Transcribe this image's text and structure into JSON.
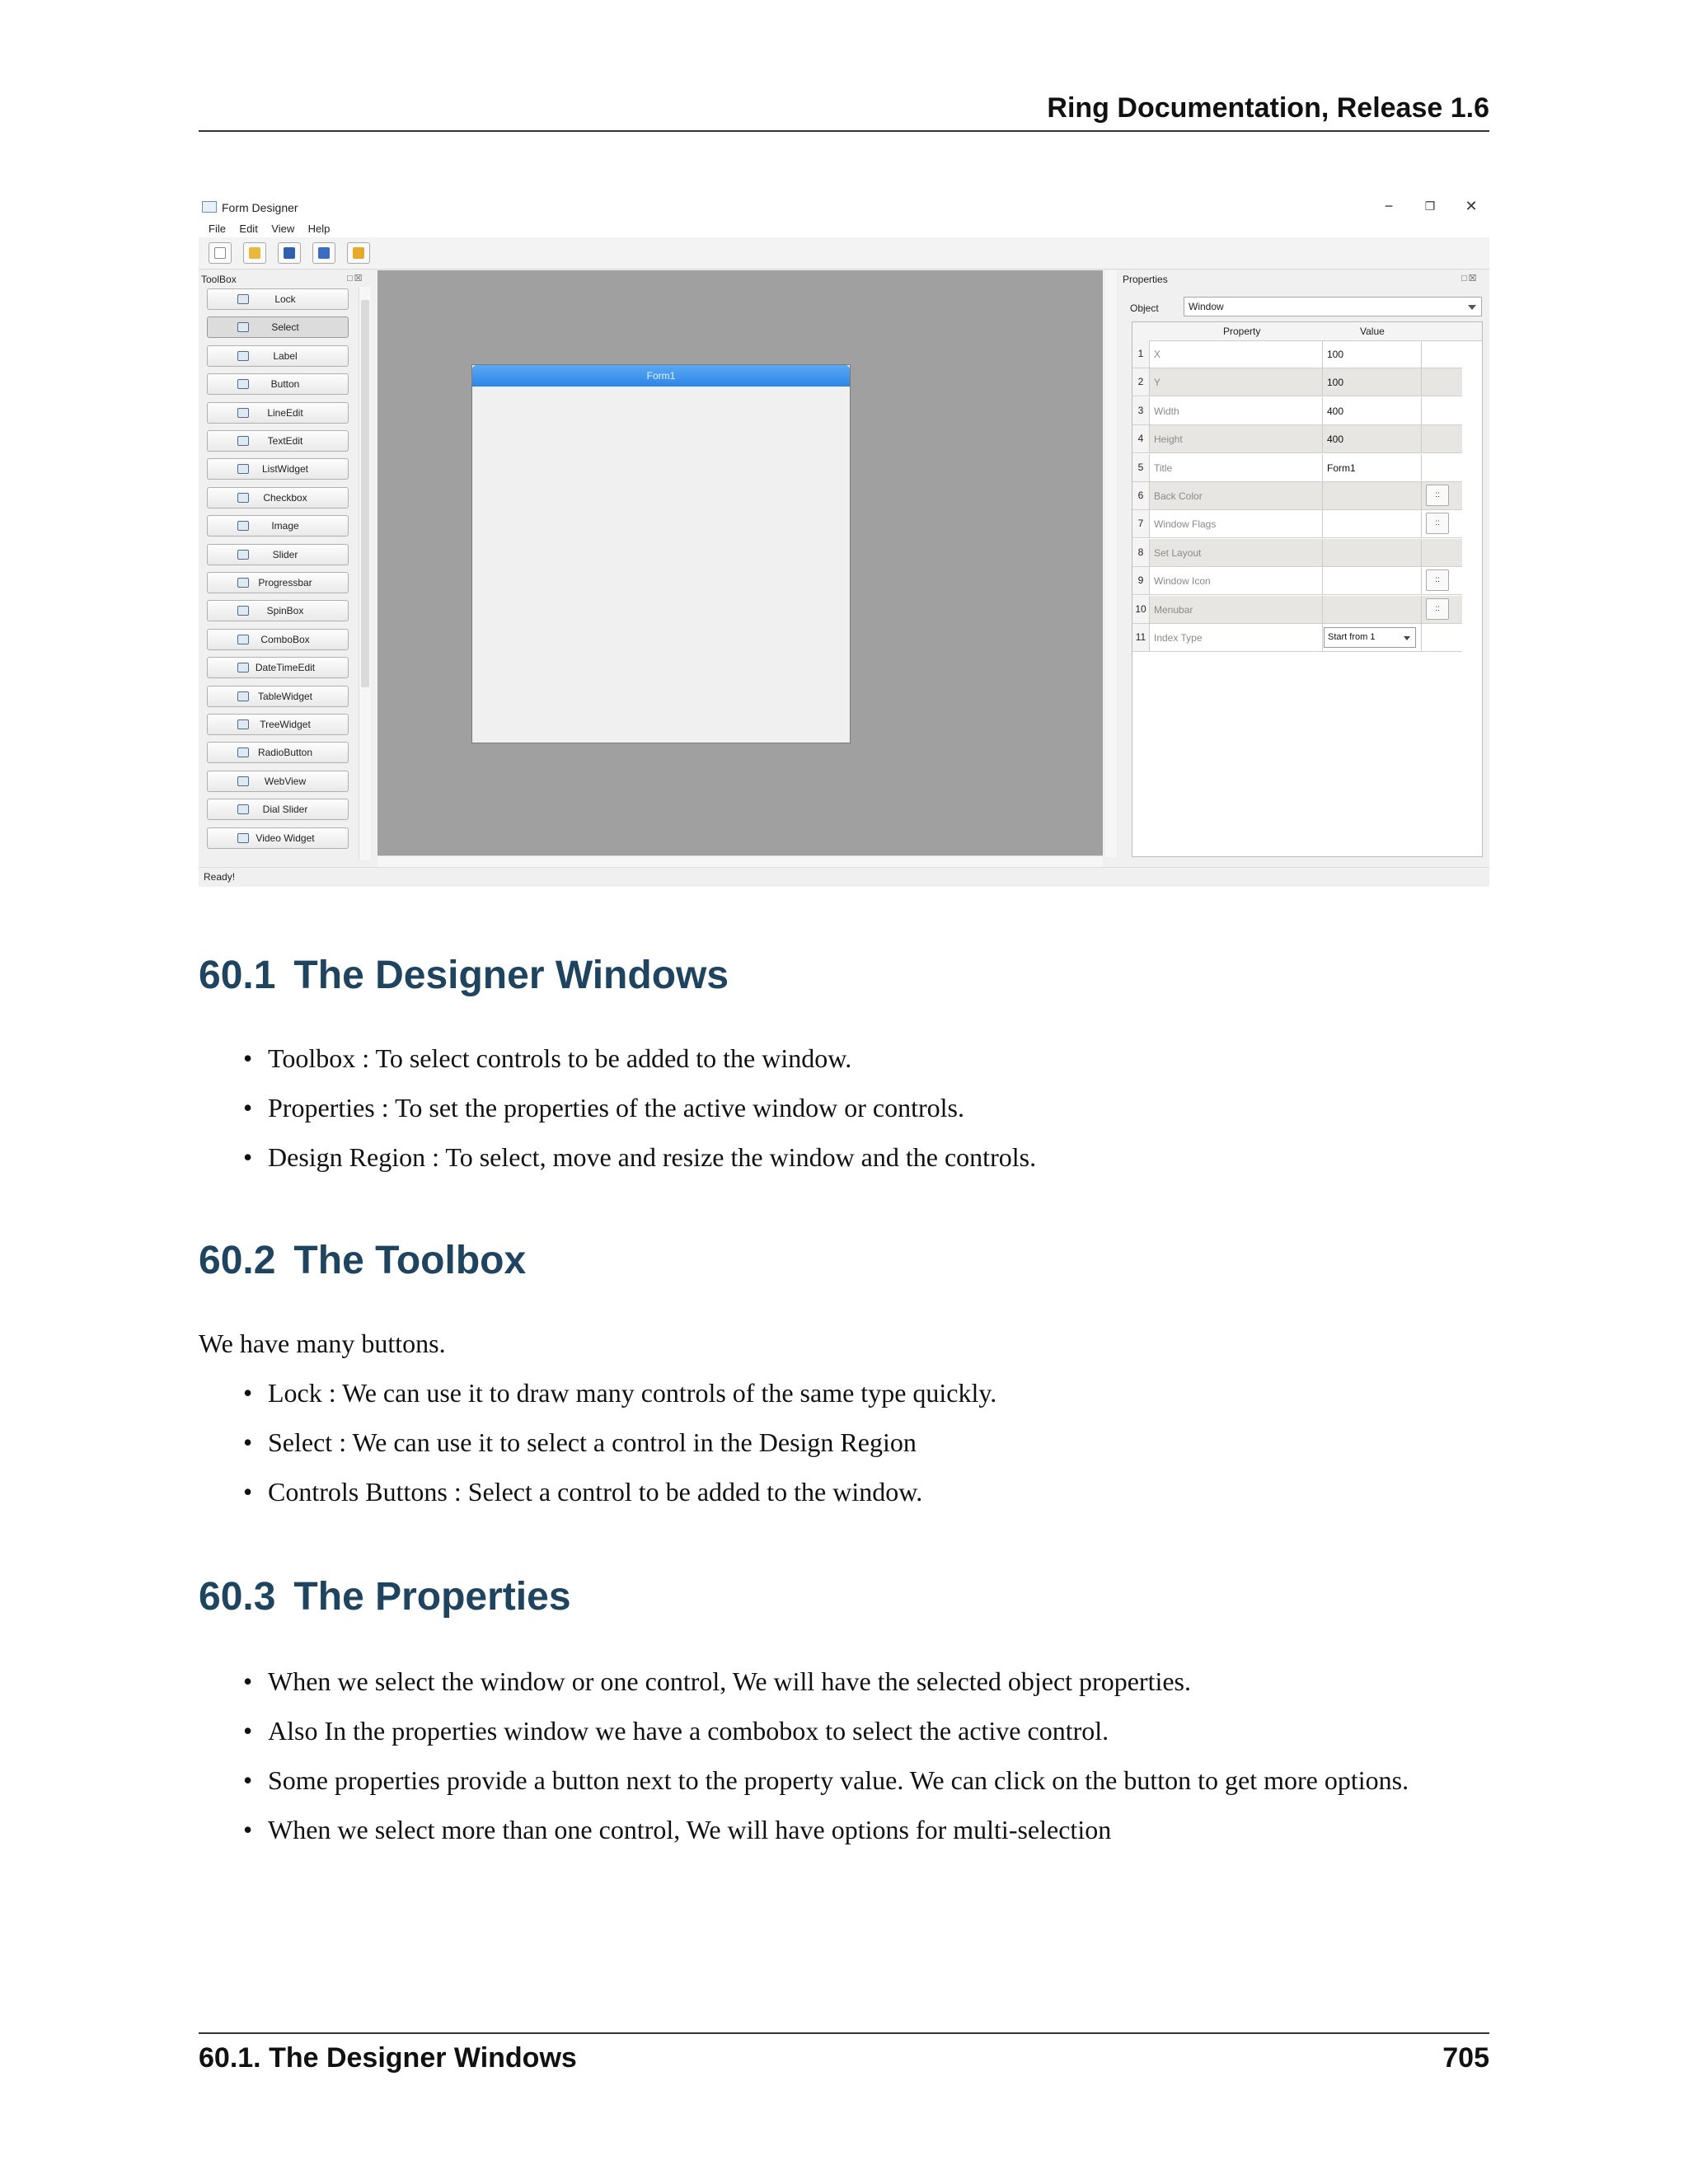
{
  "header": {
    "title": "Ring Documentation, Release 1.6"
  },
  "screenshot": {
    "window_title": "Form Designer",
    "window_controls": {
      "minimize": "−",
      "restore": "❐",
      "close": "✕"
    },
    "menu": [
      "File",
      "Edit",
      "View",
      "Help"
    ],
    "toolbar_icons": [
      "new-file-icon",
      "open-folder-icon",
      "save-icon",
      "save-as-icon",
      "open-form-icon"
    ],
    "toolbox": {
      "title": "ToolBox",
      "dock_buttons": "□☒",
      "items": [
        "Lock",
        "Select",
        "Label",
        "Button",
        "LineEdit",
        "TextEdit",
        "ListWidget",
        "Checkbox",
        "Image",
        "Slider",
        "Progressbar",
        "SpinBox",
        "ComboBox",
        "DateTimeEdit",
        "TableWidget",
        "TreeWidget",
        "RadioButton",
        "WebView",
        "Dial Slider",
        "Video Widget"
      ]
    },
    "form_caption": "Form1",
    "status": "Ready!",
    "properties": {
      "title": "Properties",
      "dock_buttons": "□☒",
      "object_label": "Object",
      "object_value": "Window",
      "col_property": "Property",
      "col_value": "Value",
      "button_glyph": "::",
      "rows": [
        {
          "num": "1",
          "name": "X",
          "value": "100"
        },
        {
          "num": "2",
          "name": "Y",
          "value": "100"
        },
        {
          "num": "3",
          "name": "Width",
          "value": "400"
        },
        {
          "num": "4",
          "name": "Height",
          "value": "400"
        },
        {
          "num": "5",
          "name": "Title",
          "value": "Form1"
        },
        {
          "num": "6",
          "name": "Back Color",
          "value": ""
        },
        {
          "num": "7",
          "name": "Window Flags",
          "value": ""
        },
        {
          "num": "8",
          "name": "Set Layout",
          "value": ""
        },
        {
          "num": "9",
          "name": "Window Icon",
          "value": ""
        },
        {
          "num": "10",
          "name": "Menubar",
          "value": ""
        },
        {
          "num": "11",
          "name": "Index Type",
          "value": "Start from 1"
        }
      ]
    }
  },
  "sections": [
    {
      "num": "60.1",
      "title": "The Designer Windows",
      "bullets": [
        "Toolbox : To select controls to be added to the window.",
        "Properties : To set the properties of the active window or controls.",
        "Design Region : To select, move and resize the window and the controls."
      ]
    },
    {
      "num": "60.2",
      "title": "The Toolbox",
      "intro": "We have many buttons.",
      "bullets": [
        "Lock : We can use it to draw many controls of the same type quickly.",
        "Select : We can use it to select a control in the Design Region",
        "Controls Buttons : Select a control to be added to the window."
      ]
    },
    {
      "num": "60.3",
      "title": "The Properties",
      "bullets": [
        "When we select the window or one control, We will have the selected object properties.",
        "Also In the properties window we have a combobox to select the active control.",
        "Some properties provide a button next to the property value. We can click on the button to get more options.",
        "When we select more than one control, We will have options for multi-selection"
      ]
    }
  ],
  "footer": {
    "section": "60.1.  The Designer Windows",
    "page": "705"
  }
}
